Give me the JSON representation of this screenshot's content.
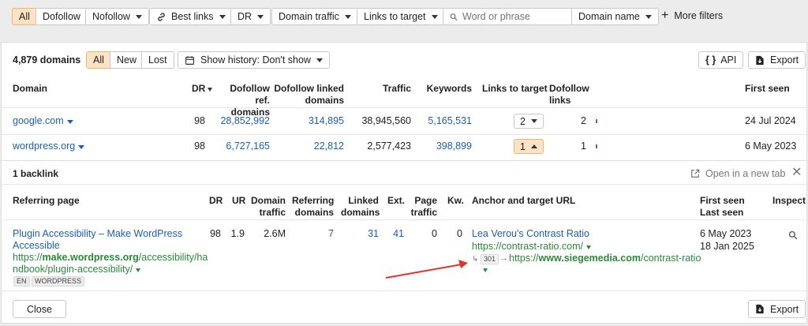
{
  "filters": {
    "all": "All",
    "dofollow": "Dofollow",
    "nofollow": "Nofollow",
    "best_links": "Best links",
    "dr": "DR",
    "domain_traffic": "Domain traffic",
    "links_to_target": "Links to target",
    "search_placeholder": "Word or phrase",
    "domain_name": "Domain name",
    "more_filters": "More filters"
  },
  "domains_panel": {
    "count": "4,879 domains",
    "seg_all": "All",
    "seg_new": "New",
    "seg_lost": "Lost",
    "history": "Show history: Don't show",
    "api": "API",
    "export": "Export",
    "headers": {
      "domain": "Domain",
      "dr": "DR",
      "dofollow_ref_1": "Dofollow ref.",
      "dofollow_ref_2": "domains",
      "dofollow_linked_1": "Dofollow linked",
      "dofollow_linked_2": "domains",
      "traffic": "Traffic",
      "keywords": "Keywords",
      "links_to_target": "Links to target",
      "dofollow_links_1": "Dofollow",
      "dofollow_links_2": "links",
      "first_seen": "First seen"
    },
    "rows": [
      {
        "domain": "google.com",
        "dr": "98",
        "ref_domains": "28,852,992",
        "linked_domains": "314,895",
        "traffic": "38,945,560",
        "keywords": "5,165,531",
        "links_to_target": "2",
        "dofollow_links": "2",
        "first_seen": "24 Jul 2024"
      },
      {
        "domain": "wordpress.org",
        "dr": "98",
        "ref_domains": "6,727,165",
        "linked_domains": "22,812",
        "traffic": "2,577,423",
        "keywords": "398,899",
        "links_to_target": "1",
        "dofollow_links": "1",
        "first_seen": "6 May 2023"
      }
    ]
  },
  "backlink_panel": {
    "title": "1 backlink",
    "open_new_tab": "Open in a new tab",
    "headers": {
      "referring_page": "Referring page",
      "dr": "DR",
      "ur": "UR",
      "domain_traffic_1": "Domain",
      "domain_traffic_2": "traffic",
      "referring_domains_1": "Referring",
      "referring_domains_2": "domains",
      "linked_domains_1": "Linked",
      "linked_domains_2": "domains",
      "ext": "Ext.",
      "page_traffic_1": "Page",
      "page_traffic_2": "traffic",
      "kw": "Kw.",
      "anchor": "Anchor and target URL",
      "first_seen": "First seen",
      "last_seen": "Last seen",
      "inspect": "Inspect"
    },
    "row": {
      "title_1": "Plugin Accessibility – Make WordPress",
      "title_2": "Accessible",
      "url_1_prefix": "https://",
      "url_1_domain": "make.wordpress.org",
      "url_1_path": "/accessibility/ha",
      "url_2": "ndbook/plugin-accessibility/",
      "tag_1": "EN",
      "tag_2": "WORDPRESS",
      "dr": "98",
      "ur": "1.9",
      "domain_traffic": "2.6M",
      "referring_domains": "7",
      "linked_domains": "31",
      "ext": "41",
      "page_traffic": "0",
      "kw": "0",
      "anchor_text": "Lea Verou's Contrast Ratio",
      "target_url": "https://contrast-ratio.com/",
      "redirect_code": "301",
      "redirect_prefix": "https://",
      "redirect_domain": "www.siegemedia.com",
      "redirect_path": "/contrast-ratio",
      "first_seen": "6 May 2023",
      "last_seen": "18 Jan 2025"
    },
    "close": "Close",
    "export": "Export"
  },
  "colors": {
    "accent_orange": "#fde2c4",
    "link_blue": "#1d5fb8",
    "url_green": "#2a8a3a",
    "arrow_red": "#e4322b"
  }
}
